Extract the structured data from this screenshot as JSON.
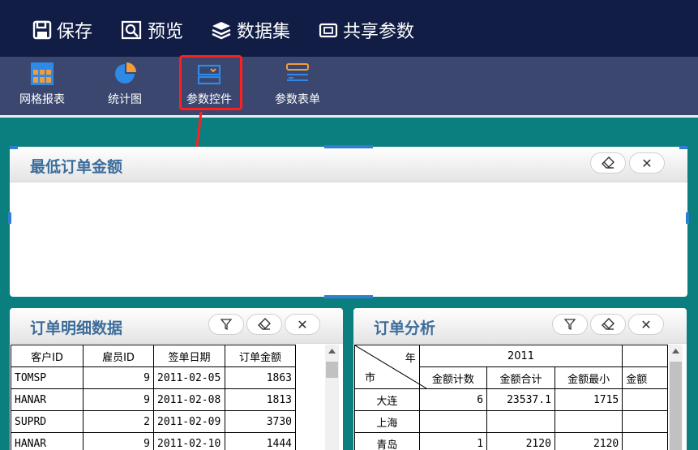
{
  "topbar": {
    "buttons": [
      {
        "label": "保存",
        "icon": "save-icon"
      },
      {
        "label": "预览",
        "icon": "preview-icon"
      },
      {
        "label": "数据集",
        "icon": "dataset-icon"
      },
      {
        "label": "共享参数",
        "icon": "shared-params-icon"
      }
    ]
  },
  "subbar": {
    "items": [
      {
        "label": "网格报表",
        "icon": "grid-report-icon"
      },
      {
        "label": "统计图",
        "icon": "pie-chart-icon"
      },
      {
        "label": "参数控件",
        "icon": "param-control-icon"
      },
      {
        "label": "参数表单",
        "icon": "param-form-icon"
      }
    ]
  },
  "colors": {
    "accent_red": "#ff1f1f",
    "title_blue": "#3d6d9b",
    "background": "#0b7f7f"
  },
  "panel_min_amount": {
    "title": "最低订单金额"
  },
  "panel_order_detail": {
    "title": "订单明细数据",
    "columns": [
      "客户ID",
      "雇员ID",
      "签单日期",
      "订单金额"
    ],
    "rows": [
      [
        "TOMSP",
        "9",
        "2011-02-05",
        "1863"
      ],
      [
        "HANAR",
        "9",
        "2011-02-08",
        "1813"
      ],
      [
        "SUPRD",
        "2",
        "2011-02-09",
        "3730"
      ],
      [
        "HANAR",
        "9",
        "2011-02-10",
        "1444"
      ]
    ]
  },
  "panel_order_analysis": {
    "title": "订单分析",
    "corner_year": "年",
    "corner_city": "市",
    "year": "2011",
    "measures": [
      "金额计数",
      "金额合计",
      "金额最小",
      "金额"
    ],
    "rows": [
      [
        "大连",
        "6",
        "23537.1",
        "1715"
      ],
      [
        "上海",
        "",
        "",
        ""
      ],
      [
        "青岛",
        "1",
        "2120",
        "2120"
      ]
    ]
  }
}
